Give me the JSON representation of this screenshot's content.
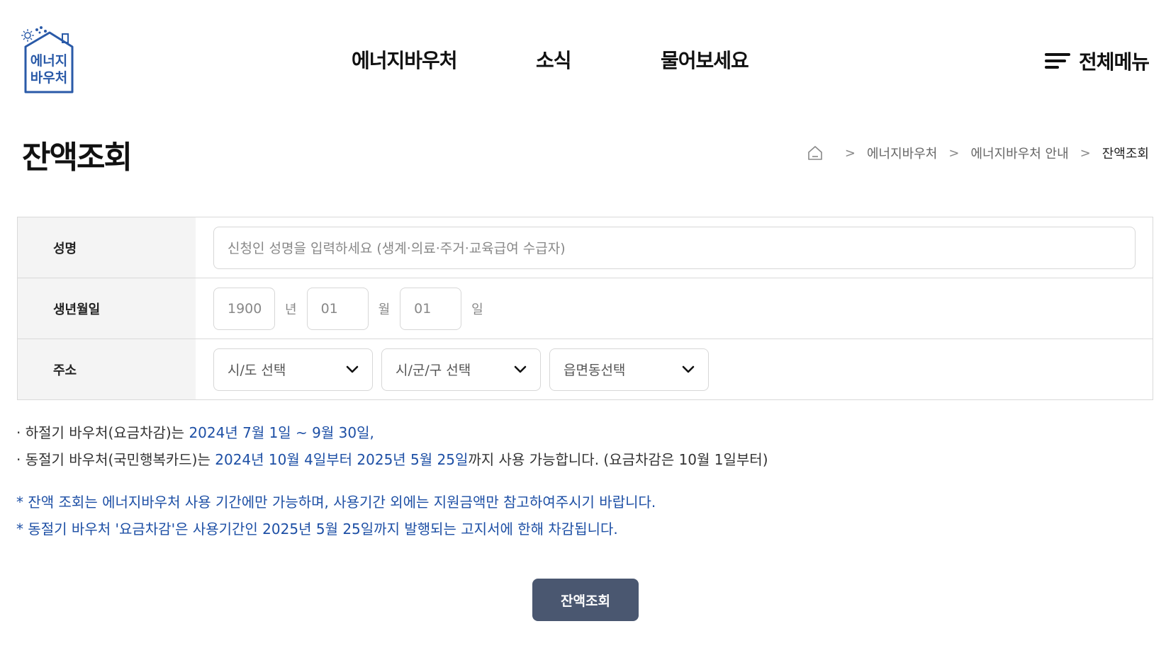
{
  "logo": {
    "line1": "에너지",
    "line2": "바우처",
    "icon": "house-sun-snow-icon",
    "color": "#2a5aa8"
  },
  "nav": {
    "items": [
      {
        "label": "에너지바우처"
      },
      {
        "label": "소식"
      },
      {
        "label": "물어보세요"
      }
    ],
    "all_menu_label": "전체메뉴"
  },
  "page": {
    "title": "잔액조회"
  },
  "breadcrumb": {
    "items": [
      {
        "label": "에너지바우처"
      },
      {
        "label": "에너지바우처 안내"
      },
      {
        "label": "잔액조회"
      }
    ]
  },
  "form": {
    "name": {
      "label": "성명",
      "placeholder": "신청인 성명을 입력하세요 (생계·의료·주거·교육급여 수급자)"
    },
    "birth": {
      "label": "생년월일",
      "year": "1900",
      "year_unit": "년",
      "month": "01",
      "month_unit": "월",
      "day": "01",
      "day_unit": "일"
    },
    "address": {
      "label": "주소",
      "sido": "시/도 선택",
      "sigungu": "시/군/구 선택",
      "eupmyeondong": "읍면동선택"
    }
  },
  "notices": {
    "summer_prefix": "· 하절기 바우처(요금차감)는 ",
    "summer_period": "2024년 7월 1일 ~ 9월 30일,",
    "winter_prefix": "· 동절기 바우처(국민행복카드)는 ",
    "winter_period": "2024년 10월 4일부터 2025년 5월 25일",
    "winter_suffix": "까지 사용 가능합니다. (요금차감은 10월 1일부터)",
    "note1": "* 잔액 조회는 에너지바우처 사용 기간에만 가능하며, 사용기간 외에는 지원금액만 참고하여주시기 바랍니다.",
    "note2": "* 동절기 바우처 '요금차감'은 사용기간인 2025년 5월 25일까지 발행되는 고지서에 한해 차감됩니다."
  },
  "buttons": {
    "query": "잔액조회"
  },
  "colors": {
    "accent_blue": "#1d4fa5",
    "button_bg": "#4a5770",
    "table_header_bg": "#f4f4f4"
  }
}
